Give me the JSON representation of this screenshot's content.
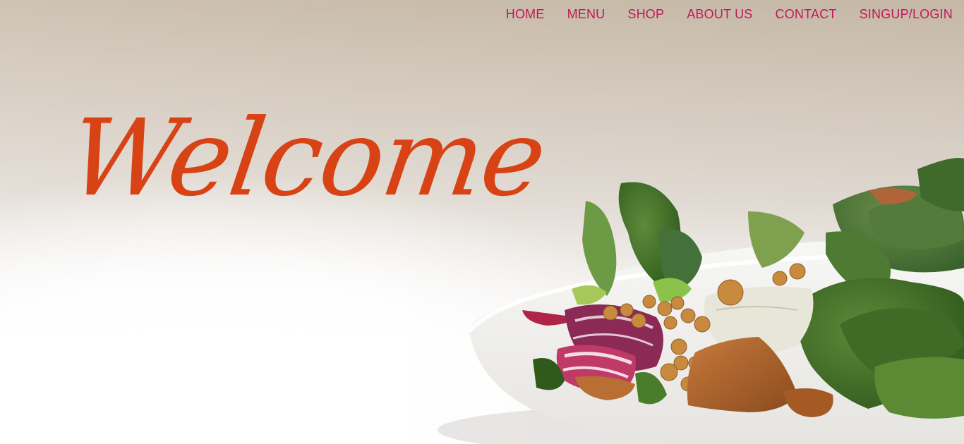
{
  "nav": {
    "items": [
      {
        "label": "HOME"
      },
      {
        "label": "MENU"
      },
      {
        "label": "SHOP"
      },
      {
        "label": "ABOUT US"
      },
      {
        "label": "CONTACT"
      },
      {
        "label": "SINGUP/LOGIN"
      }
    ]
  },
  "hero": {
    "heading": "Welcome",
    "image": "salad-bowl"
  },
  "colors": {
    "nav_text": "#c2185b",
    "heading": "#d84315"
  }
}
